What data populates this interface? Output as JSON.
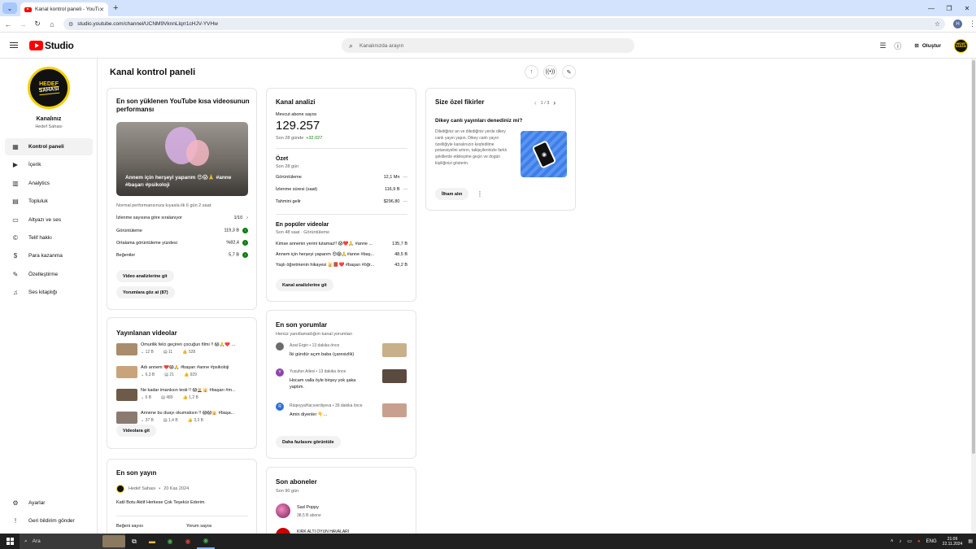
{
  "browser": {
    "tab_title": "Kanal kontrol paneli - YouTube",
    "new_tab": "+",
    "url": "studio.youtube.com/channel/UCNM9VknnLlqrr1cHJV-YVHw",
    "profile_initial": "H"
  },
  "header": {
    "logo_text": "Studio",
    "search_placeholder": "Kanalınızda arayın",
    "create_label": "Oluştur",
    "avatar_text": "HEDEF SAHASI"
  },
  "sidebar": {
    "avatar_line1": "HEDEF",
    "avatar_line2": "SAHASI",
    "channel_label": "Kanalınız",
    "channel_name": "Hedef Sahası",
    "items": [
      {
        "label": "Kontrol paneli",
        "icon": "dashboard-icon"
      },
      {
        "label": "İçerik",
        "icon": "content-icon"
      },
      {
        "label": "Analytics",
        "icon": "analytics-icon"
      },
      {
        "label": "Topluluk",
        "icon": "community-icon"
      },
      {
        "label": "Altyazı ve ses",
        "icon": "subtitles-icon"
      },
      {
        "label": "Telif hakkı",
        "icon": "copyright-icon"
      },
      {
        "label": "Para kazanma",
        "icon": "monetization-icon"
      },
      {
        "label": "Özelleştirme",
        "icon": "customization-icon"
      },
      {
        "label": "Ses kitaplığı",
        "icon": "audio-library-icon"
      }
    ],
    "settings_label": "Ayarlar",
    "feedback_label": "Geri bildirim gönder"
  },
  "main": {
    "title": "Kanal kontrol paneli"
  },
  "latest_short": {
    "title": "En son yüklenen YouTube kısa videosunun performansı",
    "thumb_caption": "Annem için herşeyi yaparım 😍😱🙏 #anne #başarı #psikoloji",
    "compare_note": "Normal performansınıza kıyasla ilk 6 gün 2 saat:",
    "rank_label": "İzlenme sayısına göre sıralanıyor",
    "rank_value": "1/10",
    "stats": [
      {
        "label": "Görüntüleme",
        "value": "119,3 B"
      },
      {
        "label": "Ortalama görüntüleme yüzdesi",
        "value": "%82,4"
      },
      {
        "label": "Beğeniler",
        "value": "5,7 B"
      }
    ],
    "btn_analytics": "Video analizlerine git",
    "btn_comments": "Yorumlara göz at (87)"
  },
  "published": {
    "title": "Yayınlanan videolar",
    "videos": [
      {
        "title": "Omurilik felci geçiren çocuğun filmi !! 😱🙏❤️ ...",
        "views": "12 B",
        "comments": "11",
        "likes": "528"
      },
      {
        "title": "Adı annem ❤️😱🙏 #başarı #anne #psikoloji",
        "views": "6,3 B",
        "comments": "21",
        "likes": "929"
      },
      {
        "title": "Ne kadar imanlısın testi !! 😱👩‍🦳🕌 #başarı #m...",
        "views": "6 B",
        "comments": "489",
        "likes": "1,2 B"
      },
      {
        "title": "Annene bu duayı okumalısın !! 😱😱🕌 #başa...",
        "views": "37 B",
        "comments": "1,4 B",
        "likes": "3,3 B"
      }
    ],
    "btn": "Videolara git"
  },
  "latest_post": {
    "title": "En son yayın",
    "author": "Hedef Sahası",
    "date": "20 Kas 2024",
    "text": "Katil Botu Aktif Herkese Çok Teşekür Ederim",
    "likes_label": "Beğeni sayısı",
    "comments_label": "Yorum sayısı"
  },
  "analytics": {
    "title": "Kanal analizi",
    "subs_label": "Mevcut abone sayısı",
    "subs_value": "129.257",
    "subs_period": "Son 28 günde",
    "subs_change": "+32.027",
    "summary_title": "Özet",
    "summary_period": "Son 28 gün",
    "summary": [
      {
        "label": "Görüntüleme",
        "value": "12,1 Mn"
      },
      {
        "label": "İzlenme süresi (saat)",
        "value": "116,9 B"
      },
      {
        "label": "Tahmini gelir",
        "value": "$296,80"
      }
    ],
    "popular_title": "En popüler videolar",
    "popular_period": "Son 48 saat · Görüntüleme",
    "popular": [
      {
        "title": "Kimse annenin yerini tutamaz!! 😱❤️🙏 #anne ...",
        "value": "135,7 B"
      },
      {
        "title": "Annem için herşeyi yaparım 😍😱🙏#anne #baş...",
        "value": "48,5 B"
      },
      {
        "title": "Yaşlı öğretmenin hikayesi 🕌📕❤️ #başarı #öğr...",
        "value": "43,2 B"
      }
    ],
    "btn": "Kanal analizlerine git"
  },
  "comments": {
    "title": "En son yorumlar",
    "subtitle": "Henüz yanıtlamadığım kanal yorumları",
    "items": [
      {
        "author": "Azat Ergin",
        "time": "13 dakika önce",
        "text": "İki gündür açım baba (çaresizlik)",
        "avatar": "",
        "avatar_color": "#6b6b6b"
      },
      {
        "author": "Yusufun Ailesi",
        "time": "13 dakika önce",
        "text": "Hocam valla öyle birşey yok şaka yaptım.",
        "avatar": "Y",
        "avatar_color": "#8e44ad"
      },
      {
        "author": "RüqeyyaHacıverdiyeva",
        "time": "39 dakika önce",
        "text": "Amin diyenler 👇...",
        "avatar": "R",
        "avatar_color": "#2e6fd6"
      }
    ],
    "btn": "Daha fazlasını görüntüle"
  },
  "subscribers": {
    "title": "Son aboneler",
    "period": "Son 90 gün",
    "items": [
      {
        "name": "Sad Poppy",
        "count": "38,5 B abone"
      },
      {
        "name": "KIRK ALTI OYUN HAVALARI",
        "count": ""
      }
    ]
  },
  "ideas": {
    "title": "Size özel fikirler",
    "pager": "1 / 3",
    "headline": "Dikey canlı yayınları denediniz mi?",
    "body": "Dilediğiniz an ve dilediğiniz yerde dikey canlı yayın yapın. Dikey canlı yayın özelliğiyle kanalınızın keşfedilme potansiyelini artırın, takipçilerinizle farklı şekillerde etkileşime geçin ve dogün kişiliğinizi gösterin.",
    "btn": "İlham alın"
  },
  "taskbar": {
    "search_label": "Ara",
    "time": "21:09",
    "date": "22.11.2024"
  },
  "colors": {
    "brand_red": "#ff0000",
    "positive_green": "#107c10",
    "accent_yellow": "#f5d000"
  }
}
